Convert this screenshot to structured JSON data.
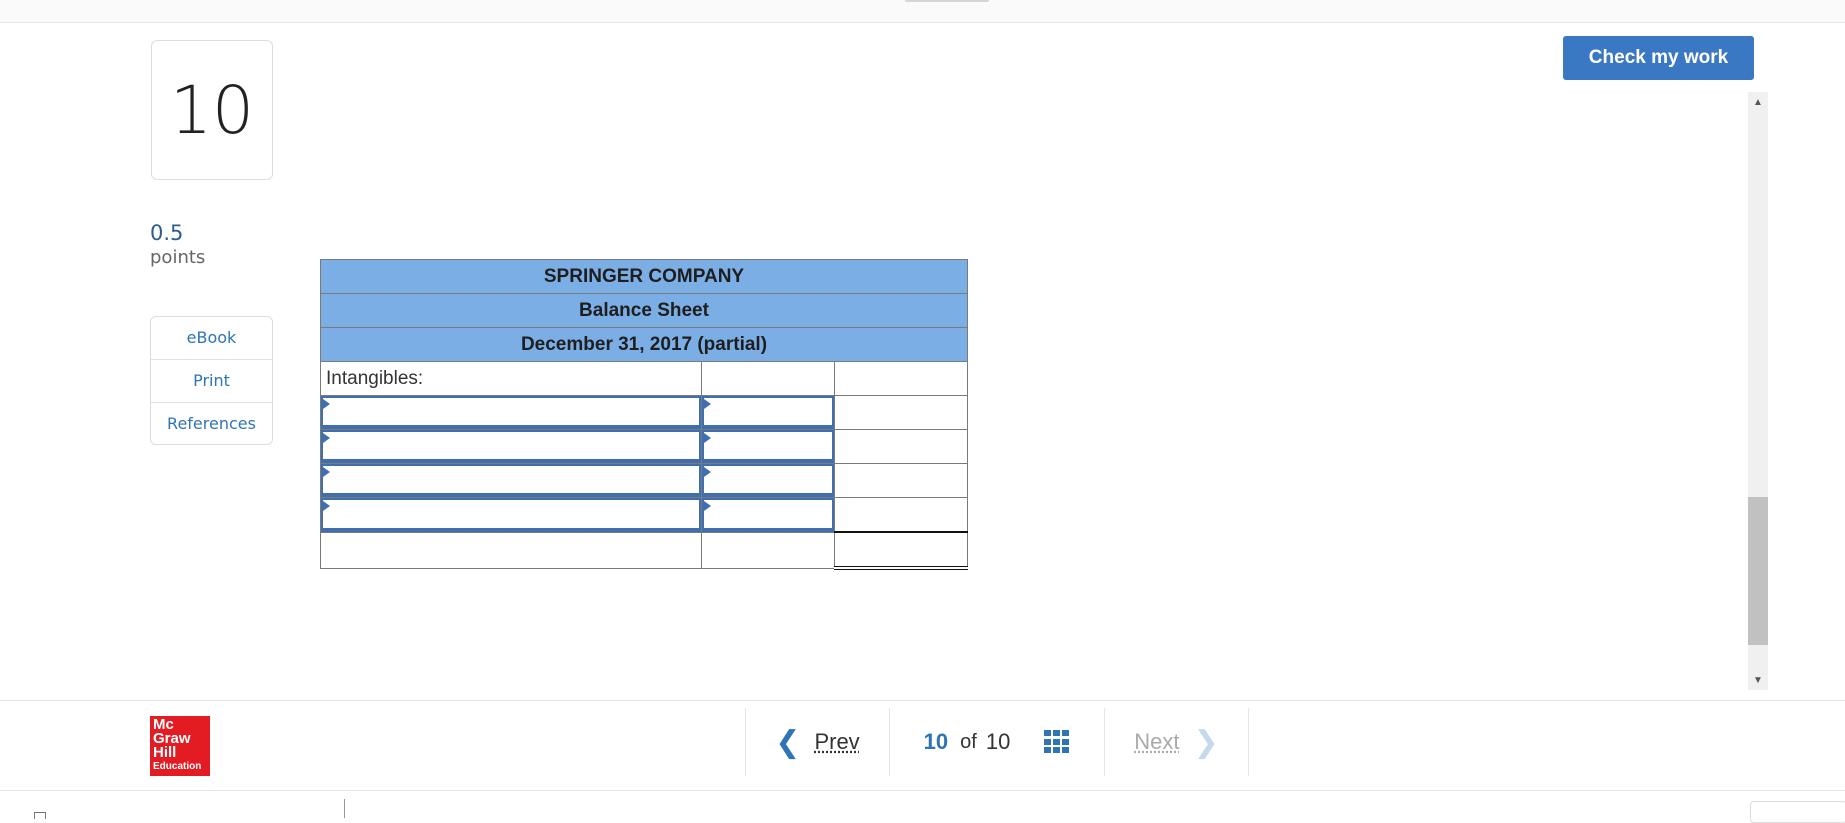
{
  "question": {
    "number": "10",
    "points_value": "0.5",
    "points_label": "points"
  },
  "resources": [
    {
      "label": "eBook"
    },
    {
      "label": "Print"
    },
    {
      "label": "References"
    }
  ],
  "check_button": {
    "label": "Check my work"
  },
  "balance_sheet": {
    "company": "SPRINGER COMPANY",
    "title": "Balance Sheet",
    "date": "December 31, 2017 (partial)",
    "first_row_label": "Intangibles:",
    "input_rows": [
      {
        "account": "",
        "amount": ""
      },
      {
        "account": "",
        "amount": ""
      },
      {
        "account": "",
        "amount": ""
      },
      {
        "account": "",
        "amount": ""
      }
    ]
  },
  "logo": {
    "line1": "Mc",
    "line2": "Graw",
    "line3": "Hill",
    "line4": "Education"
  },
  "navigation": {
    "prev_label": "Prev",
    "current": "10",
    "of_label": "of",
    "total": "10",
    "next_label": "Next"
  },
  "colors": {
    "accent": "#3b78c3",
    "table_header": "#7caee6",
    "input_border": "#3f6fae",
    "logo_red": "#e31b23"
  },
  "icons": [
    "chevron-left-icon",
    "grid-icon",
    "chevron-right-icon",
    "scroll-up-arrow-icon",
    "scroll-down-arrow-icon"
  ]
}
